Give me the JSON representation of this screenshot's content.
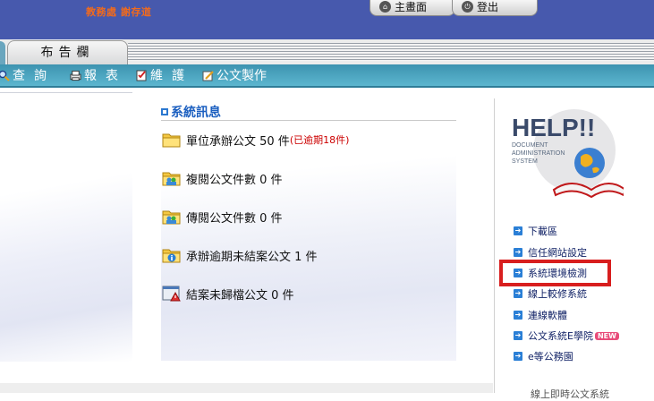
{
  "header": {
    "user_info": "教務處 謝存道",
    "home_label": "主畫面",
    "logout_label": "登出"
  },
  "tabs": {
    "bulletin": "布告欄"
  },
  "menu": {
    "query": "查詢",
    "report": "報表",
    "maintain": "維護",
    "compose": "公文製作"
  },
  "system_messages": {
    "title": "系統訊息",
    "items": [
      {
        "text": "單位承辦公文 50 件",
        "warning": "(已逾期18件)",
        "icon": "folder-icon"
      },
      {
        "text": "複閱公文件數 0 件",
        "icon": "folder-users-icon"
      },
      {
        "text": "傳閱公文件數 0 件",
        "icon": "folder-users-icon"
      },
      {
        "text": "承辦逾期未結案公文 1 件",
        "icon": "folder-info-icon"
      },
      {
        "text": "結案未歸檔公文 0 件",
        "icon": "window-warning-icon"
      }
    ]
  },
  "help": {
    "logo_title": "HELP!!",
    "logo_sub1": "DOCUMENT",
    "logo_sub2": "ADMINISTRATION",
    "logo_sub3": "SYSTEM",
    "links": [
      {
        "label": "下載區"
      },
      {
        "label": "信任網站設定"
      },
      {
        "label": "系統環境檢測"
      },
      {
        "label": "線上較修系統"
      },
      {
        "label": "連線軟體"
      },
      {
        "label": "公文系統E學院",
        "badge": "NEW"
      },
      {
        "label": "e等公務園"
      }
    ],
    "cut_text": "線上即時公文系統"
  },
  "colors": {
    "header_bg": "#4759ad",
    "menubar_bg": "#3d93b0",
    "title_blue": "#1b5fc0",
    "warning_red": "#cc0000",
    "highlight_red": "#d81e1e"
  }
}
